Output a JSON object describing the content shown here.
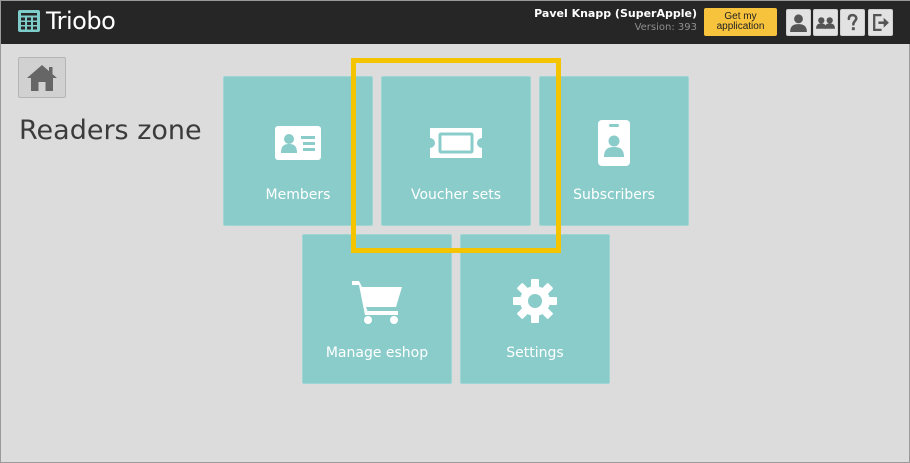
{
  "app": {
    "logo_text": "Triobo"
  },
  "header": {
    "user_name": "Pavel Knapp (SuperApple)",
    "version_label": "Version:",
    "version_value": "393",
    "get_app_line1": "Get my",
    "get_app_line2": "application",
    "icons": [
      "user-icon",
      "users-icon",
      "help-icon",
      "logout-icon"
    ],
    "colors": {
      "bar": "#262626",
      "get_app": "#f7c23c"
    }
  },
  "page": {
    "title": "Readers zone"
  },
  "tiles": [
    {
      "label": "Members",
      "icon": "member-card-icon"
    },
    {
      "label": "Voucher sets",
      "icon": "voucher-icon"
    },
    {
      "label": "Subscribers",
      "icon": "badge-icon"
    },
    {
      "label": "Manage eshop",
      "icon": "cart-icon"
    },
    {
      "label": "Settings",
      "icon": "gear-icon"
    }
  ],
  "colors": {
    "tile": "#8accca",
    "highlight": "#f4c400",
    "background": "#dcdcdc"
  }
}
